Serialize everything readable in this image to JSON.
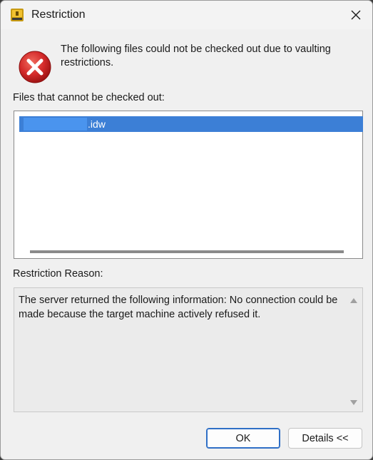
{
  "window": {
    "title": "Restriction",
    "close_icon": "close-icon",
    "app_icon": "vault-app-icon"
  },
  "message": {
    "icon": "error-icon",
    "text": "The following files could not be checked out due to vaulting restrictions."
  },
  "files": {
    "label": "Files that cannot be checked out:",
    "items": [
      {
        "name": ".idw",
        "selected": true,
        "name_prefix_redacted": true
      }
    ]
  },
  "reason": {
    "label": "Restriction Reason:",
    "text": "The server returned the following information:  No connection could be made because the target machine actively refused it."
  },
  "buttons": {
    "ok": "OK",
    "details": "Details <<"
  },
  "colors": {
    "selection": "#3c7fd6",
    "error_red": "#d42a2a",
    "default_button_border": "#2f6fc6"
  }
}
